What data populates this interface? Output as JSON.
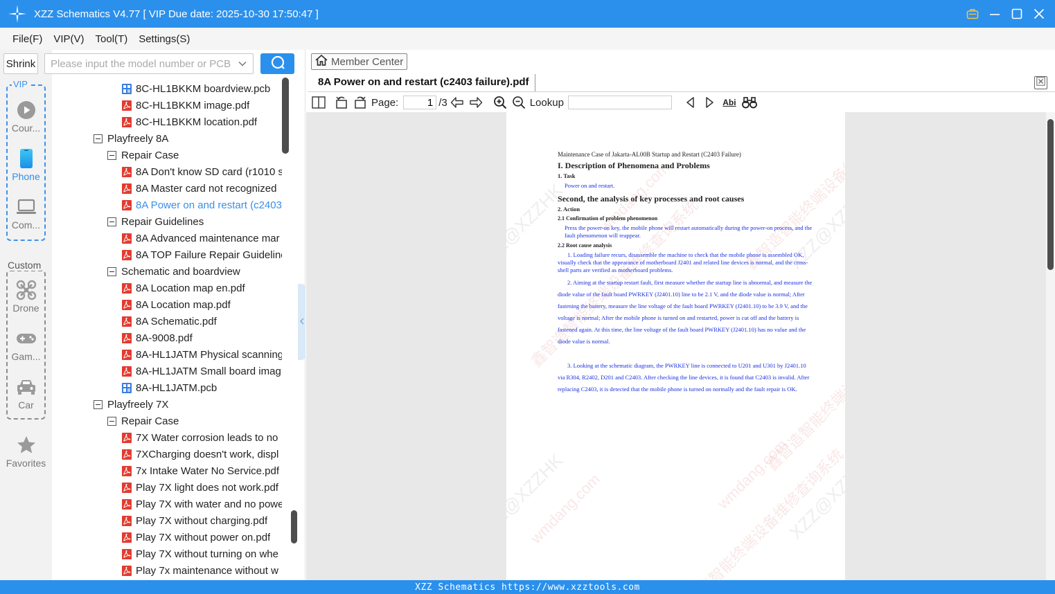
{
  "window": {
    "title": "XZZ Schematics V4.77 [ VIP Due date: 2025-10-30 17:50:47 ]",
    "accent": "#2b90ec"
  },
  "menu": [
    "File(F)",
    "VIP(V)",
    "Tool(T)",
    "Settings(S)"
  ],
  "left_nav": {
    "shrink_label": "Shrink",
    "vip_label": "VIP",
    "custom_label": "Custom",
    "vip_items": [
      {
        "label": "Cour...",
        "icon": "play-circle-icon",
        "active": false
      },
      {
        "label": "Phone",
        "icon": "phone-icon",
        "active": true
      },
      {
        "label": "Com...",
        "icon": "laptop-icon",
        "active": false
      }
    ],
    "custom_items": [
      {
        "label": "Drone",
        "icon": "drone-icon"
      },
      {
        "label": "Gam...",
        "icon": "gamepad-icon"
      },
      {
        "label": "Car",
        "icon": "car-icon"
      }
    ],
    "favorites_label": "Favorites"
  },
  "search": {
    "placeholder": "Please input the model number or PCB"
  },
  "tree": [
    {
      "level": 3,
      "type": "pcb",
      "label": "8C-HL1BKKM boardview.pcb"
    },
    {
      "level": 3,
      "type": "pdf",
      "label": "8C-HL1BKKM image.pdf"
    },
    {
      "level": 3,
      "type": "pdf",
      "label": "8C-HL1BKKM location.pdf"
    },
    {
      "level": 1,
      "type": "folder",
      "label": "Playfreely 8A"
    },
    {
      "level": 2,
      "type": "folder",
      "label": "Repair Case"
    },
    {
      "level": 3,
      "type": "pdf",
      "label": "8A Don't know SD card (r1010 s"
    },
    {
      "level": 3,
      "type": "pdf",
      "label": "8A Master card not recognized"
    },
    {
      "level": 3,
      "type": "pdf",
      "label": "8A Power on and restart (c2403",
      "selected": true
    },
    {
      "level": 2,
      "type": "folder",
      "label": "Repair Guidelines"
    },
    {
      "level": 3,
      "type": "pdf",
      "label": "8A Advanced maintenance mar"
    },
    {
      "level": 3,
      "type": "pdf",
      "label": "8A TOP Failure Repair Guideline"
    },
    {
      "level": 2,
      "type": "folder",
      "label": "Schematic and boardview"
    },
    {
      "level": 3,
      "type": "pdf",
      "label": "8A Location map en.pdf"
    },
    {
      "level": 3,
      "type": "pdf",
      "label": "8A Location map.pdf"
    },
    {
      "level": 3,
      "type": "pdf",
      "label": "8A Schematic.pdf"
    },
    {
      "level": 3,
      "type": "pdf",
      "label": "8A-9008.pdf"
    },
    {
      "level": 3,
      "type": "pdf",
      "label": "8A-HL1JATM Physical scanning"
    },
    {
      "level": 3,
      "type": "pdf",
      "label": "8A-HL1JATM Small board imag"
    },
    {
      "level": 3,
      "type": "pcb",
      "label": "8A-HL1JATM.pcb"
    },
    {
      "level": 1,
      "type": "folder",
      "label": "Playfreely 7X"
    },
    {
      "level": 2,
      "type": "folder",
      "label": "Repair Case"
    },
    {
      "level": 3,
      "type": "pdf",
      "label": "7X Water corrosion leads to no"
    },
    {
      "level": 3,
      "type": "pdf",
      "label": "7XCharging doesn't work, displ"
    },
    {
      "level": 3,
      "type": "pdf",
      "label": "7x Intake Water No Service.pdf"
    },
    {
      "level": 3,
      "type": "pdf",
      "label": "Play 7X light does not work.pdf"
    },
    {
      "level": 3,
      "type": "pdf",
      "label": "Play 7X with water and no powe"
    },
    {
      "level": 3,
      "type": "pdf",
      "label": "Play 7X without charging.pdf"
    },
    {
      "level": 3,
      "type": "pdf",
      "label": "Play 7X without power on.pdf"
    },
    {
      "level": 3,
      "type": "pdf",
      "label": "Play 7X without turning on whe"
    },
    {
      "level": 3,
      "type": "pdf",
      "label": "Play 7x maintenance without w"
    }
  ],
  "right": {
    "member_center": "Member Center",
    "doc_tab_title": "8A Power on and restart (c2403 failure).pdf",
    "toolbar": {
      "page_label": "Page:",
      "page_value": "1",
      "page_total": "/3",
      "lookup_label": "Lookup",
      "abi_label": "Abi"
    }
  },
  "pdf": {
    "header": "Maintenance Case of Jakarta-AL00B Startup and Restart (C2403 Failure)",
    "h1": "I. Description of Phenomena and Problems",
    "task_heading": "1. Task",
    "task_text": "Power on and restart.",
    "h_second": "Second, the analysis of key processes and root causes",
    "action_heading": "2. Action",
    "confirm_heading": "2.1 Confirmation of problem phenomenon",
    "confirm_text": "Press the power-on key, the mobile phone will restart automatically during the power-on process, and the fault phenomenon will reappear.",
    "root_heading": "2.2   Root cause analysis",
    "para1": "1. Loading failure recurs, disassemble the machine to check that the mobile phone is assembled OK, visually check that the appearance of motherboard J2401 and related line devices is normal, and the cross-shell parts are verified as motherboard problems.",
    "para2": "2. Aiming at the startup restart fault, first measure whether the startup line is abnormal, and measure the diode value of the fault board PWRKEY (J2401.10) line to be 2.1 V, and the diode value is normal; After fastening the battery, measure the line voltage of the fault board PWRKEY (J2401.10) to be 3.9 V, and the voltage is normal; After the mobile phone is turned on and restarted, power is cut off and the battery is fastened again. At this time, the line voltage of the fault board PWRKEY (J2401.10) has no value and the diode value is normal.",
    "para3": "3. Looking at the schematic diagram, the PWRKEY line is connected to U201 and U301 by J2401.10 via R304, R2402, D201 and C2403. After checking the line devices, it is found that C2403 is invalid. After replacing C2403, it is detected that the mobile phone is turned on normally and the fault repair is OK.",
    "watermarks": [
      "XZZ@XZZHK",
      "wmdang.com",
      "鑫智造智能终端设备维修查询系统"
    ]
  },
  "status_bar": "XZZ Schematics https://www.xzztools.com"
}
